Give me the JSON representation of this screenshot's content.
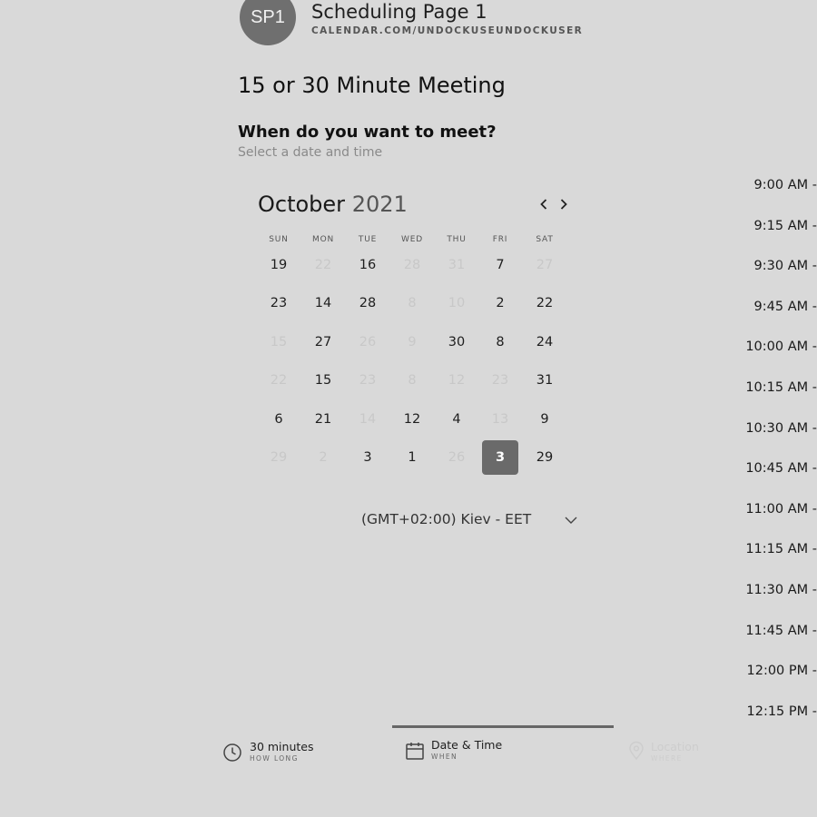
{
  "header": {
    "avatar_initials": "SP1",
    "page_name": "Scheduling Page 1",
    "page_url": "CALENDAR.COM/UNDOCKUSEUNDOCKUSER"
  },
  "meeting": {
    "title": "15 or 30 Minute Meeting",
    "question": "When do you want to meet?",
    "subquestion": "Select a date and time"
  },
  "calendar": {
    "month": "October",
    "year": "2021",
    "weekdays": [
      "SUN",
      "MON",
      "TUE",
      "WED",
      "THU",
      "FRI",
      "SAT"
    ],
    "rows": [
      [
        {
          "d": "19",
          "s": "on"
        },
        {
          "d": "22",
          "s": "dis"
        },
        {
          "d": "16",
          "s": "on"
        },
        {
          "d": "28",
          "s": "dis"
        },
        {
          "d": "31",
          "s": "dis"
        },
        {
          "d": "7",
          "s": "on"
        },
        {
          "d": "27",
          "s": "dis"
        }
      ],
      [
        {
          "d": "23",
          "s": "on"
        },
        {
          "d": "14",
          "s": "on"
        },
        {
          "d": "28",
          "s": "on"
        },
        {
          "d": "8",
          "s": "dis"
        },
        {
          "d": "10",
          "s": "dis"
        },
        {
          "d": "2",
          "s": "on"
        },
        {
          "d": "22",
          "s": "on"
        }
      ],
      [
        {
          "d": "15",
          "s": "dis"
        },
        {
          "d": "27",
          "s": "on"
        },
        {
          "d": "26",
          "s": "dis"
        },
        {
          "d": "9",
          "s": "dis"
        },
        {
          "d": "30",
          "s": "on"
        },
        {
          "d": "8",
          "s": "on"
        },
        {
          "d": "24",
          "s": "on"
        }
      ],
      [
        {
          "d": "22",
          "s": "dis"
        },
        {
          "d": "15",
          "s": "on"
        },
        {
          "d": "23",
          "s": "dis"
        },
        {
          "d": "8",
          "s": "dis"
        },
        {
          "d": "12",
          "s": "dis"
        },
        {
          "d": "23",
          "s": "dis"
        },
        {
          "d": "31",
          "s": "on"
        }
      ],
      [
        {
          "d": "6",
          "s": "on"
        },
        {
          "d": "21",
          "s": "on"
        },
        {
          "d": "14",
          "s": "dis"
        },
        {
          "d": "12",
          "s": "on"
        },
        {
          "d": "4",
          "s": "on"
        },
        {
          "d": "13",
          "s": "dis"
        },
        {
          "d": "9",
          "s": "on"
        }
      ],
      [
        {
          "d": "29",
          "s": "dis"
        },
        {
          "d": "2",
          "s": "dis"
        },
        {
          "d": "3",
          "s": "on"
        },
        {
          "d": "1",
          "s": "on"
        },
        {
          "d": "26",
          "s": "dis"
        },
        {
          "d": "3",
          "s": "sel"
        },
        {
          "d": "29",
          "s": "on"
        }
      ]
    ],
    "timezone": "(GMT+02:00) Kiev - EET",
    "icons": {
      "prev": "chevron-left-icon",
      "next": "chevron-right-icon",
      "timezone": "chevron-down-icon"
    }
  },
  "time_slots": [
    "9:00 AM -",
    "9:15 AM -",
    "9:30 AM -",
    "9:45 AM -",
    "10:00 AM -",
    "10:15 AM -",
    "10:30 AM -",
    "10:45 AM -",
    "11:00 AM -",
    "11:15 AM -",
    "11:30 AM -",
    "11:45 AM -",
    "12:00 PM -",
    "12:15 PM -"
  ],
  "steps": {
    "duration": {
      "title": "30 minutes",
      "sub": "HOW LONG",
      "icon": "clock-icon"
    },
    "datetime": {
      "title": "Date & Time",
      "sub": "WHEN",
      "icon": "calendar-icon"
    },
    "location": {
      "title": "Location",
      "sub": "WHERE",
      "icon": "location-pin-icon"
    }
  },
  "colors": {
    "background": "#d9d9d9",
    "selected_day": "#6a6a6a",
    "avatar": "#6f6f6f"
  }
}
